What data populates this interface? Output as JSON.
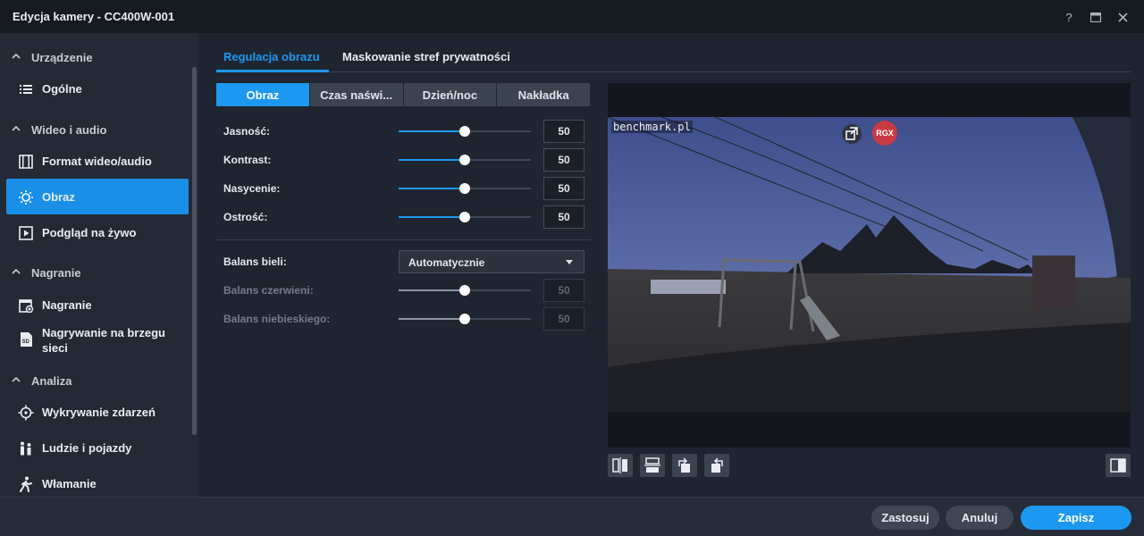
{
  "window": {
    "title": "Edycja kamery - CC400W-001"
  },
  "sidebar": {
    "groups": [
      {
        "label": "Urządzenie"
      },
      {
        "label": "Wideo i audio"
      },
      {
        "label": "Nagranie"
      },
      {
        "label": "Analiza"
      }
    ],
    "items": [
      {
        "label": "Ogólne",
        "icon": "list-icon"
      },
      {
        "label": "Format wideo/audio",
        "icon": "film-icon"
      },
      {
        "label": "Obraz",
        "icon": "sun-icon",
        "active": true
      },
      {
        "label": "Podgląd na żywo",
        "icon": "play-icon"
      },
      {
        "label": "Nagranie",
        "icon": "calendar-record-icon"
      },
      {
        "label": "Nagrywanie na brzegu sieci",
        "icon": "sd-card-icon"
      },
      {
        "label": "Wykrywanie zdarzeń",
        "icon": "crosshair-icon"
      },
      {
        "label": "Ludzie i pojazdy",
        "icon": "people-icon"
      },
      {
        "label": "Włamanie",
        "icon": "walking-person-icon"
      }
    ]
  },
  "tabs": [
    {
      "label": "Regulacja obrazu",
      "active": true
    },
    {
      "label": "Maskowanie stref prywatności",
      "active": false
    }
  ],
  "subtabs": [
    {
      "label": "Obraz",
      "active": true
    },
    {
      "label": "Czas naświ..."
    },
    {
      "label": "Dzień/noc"
    },
    {
      "label": "Nakładka"
    }
  ],
  "settings": {
    "brightness": {
      "label": "Jasność:",
      "value": "50",
      "level": 0.5
    },
    "contrast": {
      "label": "Kontrast:",
      "value": "50",
      "level": 0.5
    },
    "saturation": {
      "label": "Nasycenie:",
      "value": "50",
      "level": 0.5
    },
    "sharpness": {
      "label": "Ostrość:",
      "value": "50",
      "level": 0.5
    },
    "white_balance": {
      "label": "Balans bieli:",
      "value": "Automatycznie"
    },
    "red_balance": {
      "label": "Balans czerwieni:",
      "value": "50",
      "level": 0.5,
      "disabled": true
    },
    "blue_balance": {
      "label": "Balans niebieskiego:",
      "value": "50",
      "level": 0.5,
      "disabled": true
    }
  },
  "preview": {
    "watermark": "benchmark.pl",
    "rgx_label": "RGX",
    "controls": [
      "flip-horizontal-icon",
      "flip-vertical-icon",
      "rotate-left-icon",
      "rotate-right-icon",
      "split-view-icon"
    ]
  },
  "footer": {
    "apply": "Zastosuj",
    "cancel": "Anuluj",
    "save": "Zapisz"
  },
  "colors": {
    "accent": "#1d98f0",
    "background": "#1f2530",
    "sidebar": "#232a35",
    "rgx_badge": "#c93a44"
  }
}
